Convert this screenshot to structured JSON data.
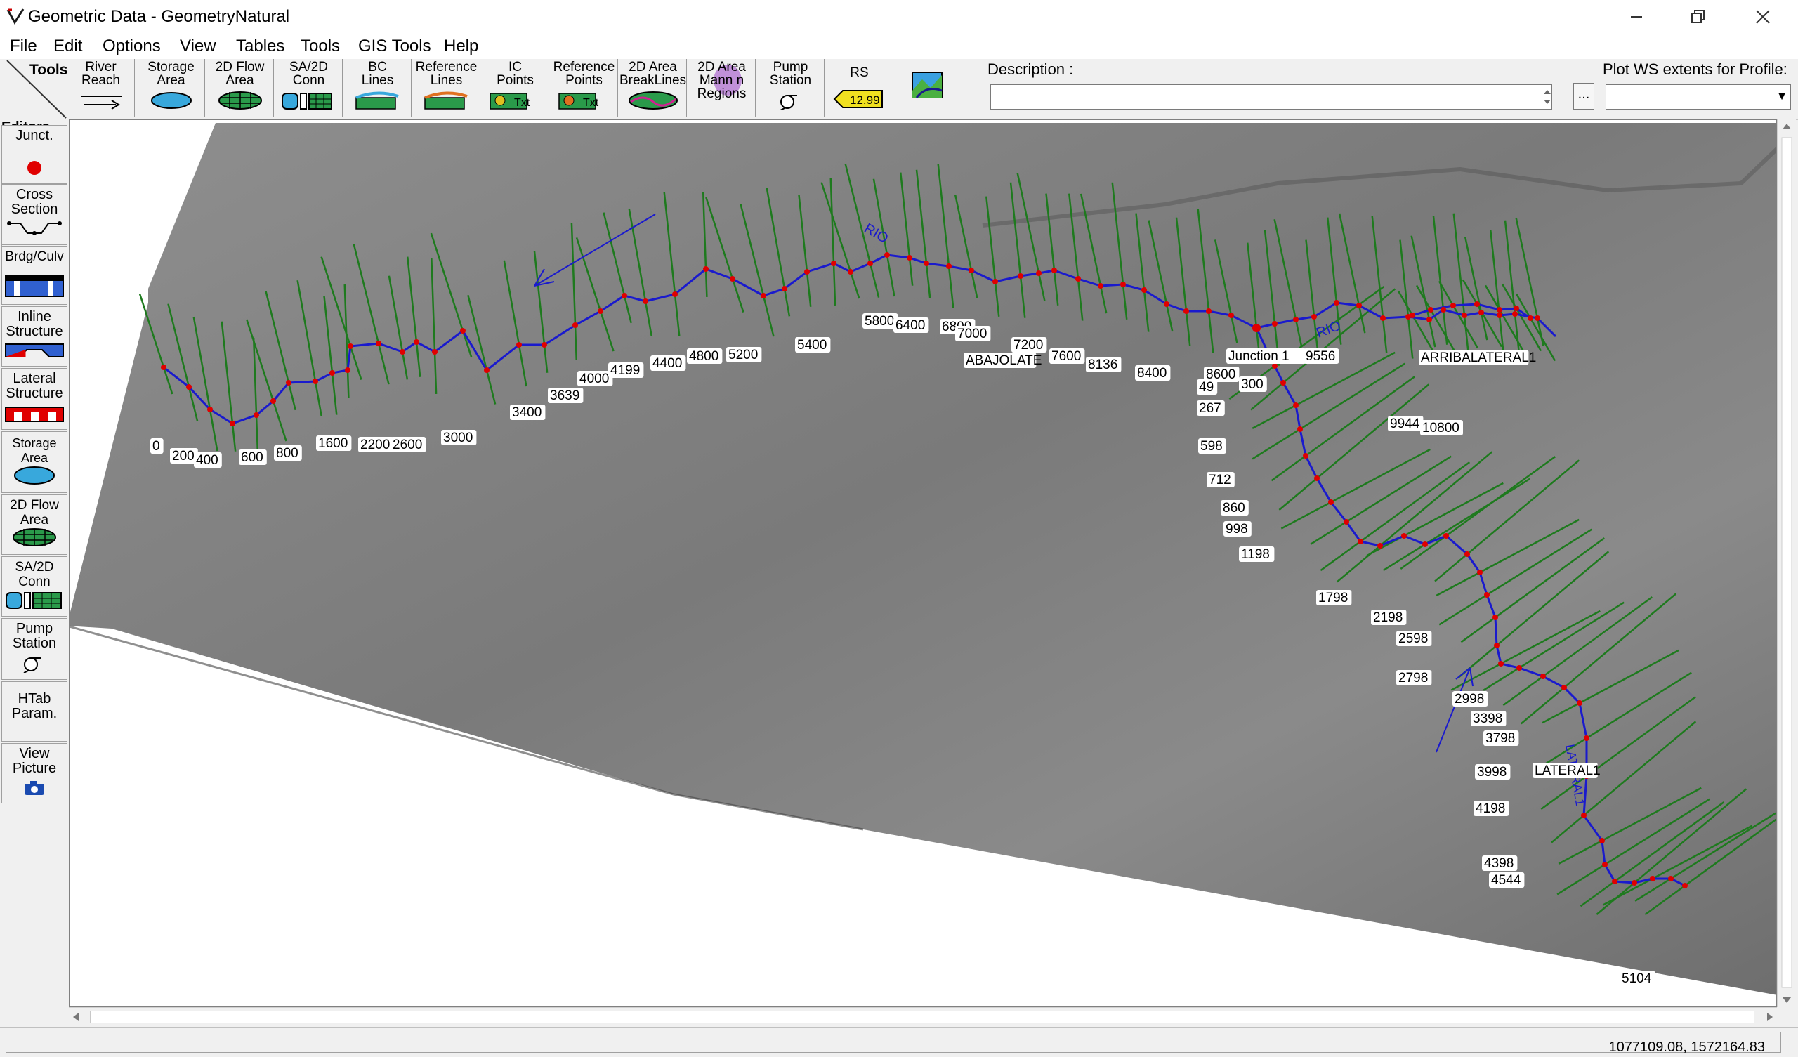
{
  "window": {
    "title": "Geometric Data - GeometryNatural",
    "controls": [
      "minimize-icon",
      "restore-icon",
      "close-icon"
    ]
  },
  "menu": [
    "File",
    "Edit",
    "Options",
    "View",
    "Tables",
    "Tools",
    "GIS Tools",
    "Help"
  ],
  "toolbar": {
    "tools_label": "Tools",
    "buttons": [
      {
        "label": "River\nReach",
        "icon": "river-reach-icon"
      },
      {
        "label": "Storage\nArea",
        "icon": "storage-area-icon"
      },
      {
        "label": "2D Flow\nArea",
        "icon": "flow-area-icon"
      },
      {
        "label": "SA/2D\nConn",
        "icon": "sa2d-conn-icon"
      },
      {
        "label": "BC\nLines",
        "icon": "bc-lines-icon"
      },
      {
        "label": "Reference\nLines",
        "icon": "reference-lines-icon"
      },
      {
        "label": "IC\nPoints",
        "icon": "ic-points-icon"
      },
      {
        "label": "Reference\nPoints",
        "icon": "reference-points-icon"
      },
      {
        "label": "2D Area\nBreakLines",
        "icon": "breaklines-icon"
      },
      {
        "label": "2D Area\nMann n\nRegions",
        "icon": "mann-regions-icon"
      },
      {
        "label": "Pump\nStation",
        "icon": "pump-station-icon"
      },
      {
        "label": "RS",
        "icon": "rs-icon",
        "badge": "12.99"
      },
      {
        "label": "",
        "icon": "map-icon"
      }
    ],
    "description_label": "Description :",
    "description_value": "",
    "browse_label": "...",
    "plot_label": "Plot WS extents for Profile:",
    "plot_value": ""
  },
  "editors": {
    "title": "Editors",
    "buttons": [
      {
        "label": "Junct.",
        "icon": "junction-icon"
      },
      {
        "label": "Cross\nSection",
        "icon": "cross-section-icon"
      },
      {
        "label": "Brdg/Culv",
        "icon": "bridge-culvert-icon"
      },
      {
        "label": "Inline\nStructure",
        "icon": "inline-structure-icon"
      },
      {
        "label": "Lateral\nStructure",
        "icon": "lateral-structure-icon"
      },
      {
        "label": "Storage\nArea",
        "icon": "storage-area-icon"
      },
      {
        "label": "2D Flow\nArea",
        "icon": "flow-area-icon"
      },
      {
        "label": "SA/2D\nConn",
        "icon": "sa2d-conn-icon"
      },
      {
        "label": "Pump\nStation",
        "icon": "pump-station-icon"
      },
      {
        "label": "HTab\nParam.",
        "icon": ""
      },
      {
        "label": "View\nPicture",
        "icon": "camera-icon"
      }
    ]
  },
  "map": {
    "reach_labels": [
      "ABAJOLATE",
      "ARRIBALATERAL1",
      "LATERAL1"
    ],
    "junction_label": "Junction 1",
    "river_text": [
      "RIO",
      "RIO",
      "LATERAL1"
    ],
    "colors": {
      "river": "#1a1acd",
      "xs": "#1e7a1e",
      "node": "#e00000",
      "junction": "#e00000"
    },
    "main_stations": [
      "0",
      "200",
      "400",
      "600",
      "800",
      "1600",
      "2200",
      "2600",
      "3000",
      "3400",
      "3639",
      "4000",
      "4199",
      "4400",
      "4800",
      "5200",
      "5400",
      "5800",
      "6400",
      "6800",
      "7000",
      "7200",
      "7600",
      "8136",
      "8400",
      "8600",
      "9556",
      "9944",
      "10800"
    ],
    "lateral_stations": [
      "49",
      "267",
      "598",
      "712",
      "860",
      "998",
      "1198",
      "1798",
      "2198",
      "2598",
      "2798",
      "2998",
      "3398",
      "3798",
      "3998",
      "4198",
      "4398",
      "4544",
      "5104"
    ],
    "extra_station": "300"
  },
  "status": {
    "coords": "1077109.08, 1572164.83"
  }
}
